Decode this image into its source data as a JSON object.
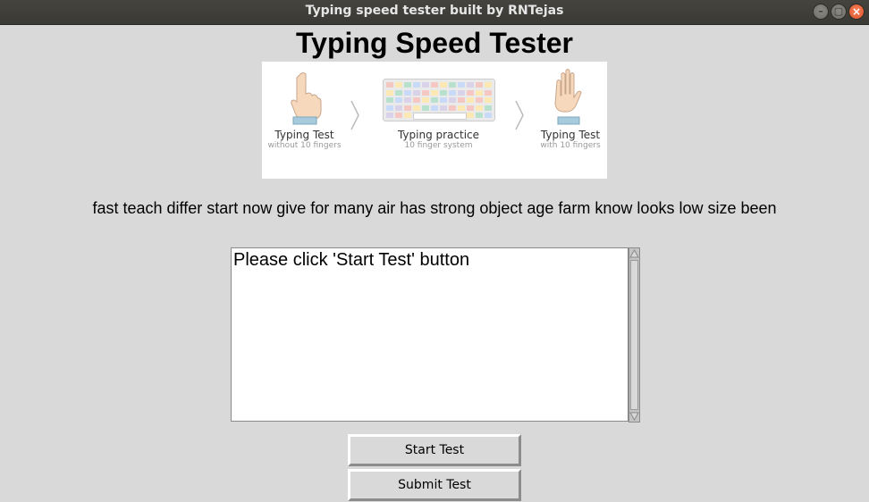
{
  "window": {
    "title": "Typing speed tester built by RNTejas",
    "controls": {
      "minimize": "–",
      "maximize": "▢",
      "close": "×"
    }
  },
  "app": {
    "heading": "Typing Speed Tester",
    "banner": {
      "steps": [
        {
          "label": "Typing Test",
          "sub": "without 10 fingers",
          "icon": "pointing-hand-icon"
        },
        {
          "label": "Typing practice",
          "sub": "10 finger system",
          "icon": "keyboard-icon"
        },
        {
          "label": "Typing Test",
          "sub": "with 10 fingers",
          "icon": "open-hand-icon"
        }
      ]
    },
    "sample_words": "fast teach differ start now give for many air has strong object age farm know looks low size been",
    "input": {
      "value": "Please click 'Start Test' button"
    },
    "buttons": {
      "start": "Start Test",
      "submit": "Submit Test"
    }
  }
}
